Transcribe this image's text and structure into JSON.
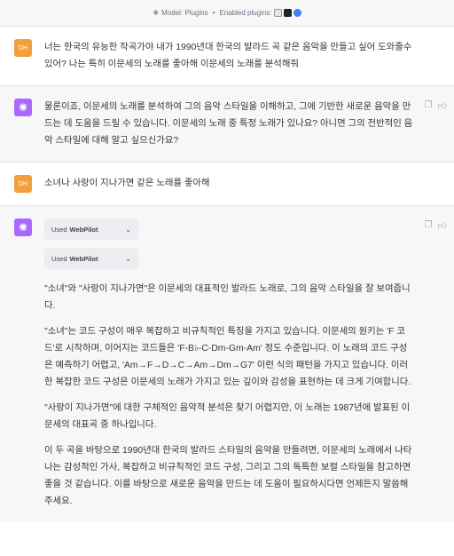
{
  "header": {
    "model_label": "Model: Plugins",
    "separator": "•",
    "plugins_label": "Enabled plugins:"
  },
  "messages": [
    {
      "role": "user",
      "avatar_text": "DH",
      "text": "너는 한국의 유능한 작곡가야 내가 1990년대 한국의 발라드 곡 같은 음악을 만들고 싶어 도와줄수 있어? 나는 특히 이문세의 노래를 좋아해 이문세의 노래를 분석해줘"
    },
    {
      "role": "assistant",
      "text": "물론이죠, 이문세의 노래를 분석하여 그의 음악 스타일을 이해하고, 그에 기반한 새로운 음악을 만드는 데 도움을 드릴 수 있습니다. 이문세의 노래 중 특정 노래가 있나요? 아니면 그의 전반적인 음악 스타일에 대해 알고 싶으신가요?"
    },
    {
      "role": "user",
      "avatar_text": "DH",
      "text": "소녀나 사랑이 지나가면 같은 노래를 좋아해"
    },
    {
      "role": "assistant",
      "plugin_chips": [
        {
          "prefix": "Used",
          "name": "WebPilot"
        },
        {
          "prefix": "Used",
          "name": "WebPilot"
        }
      ],
      "paragraphs": [
        "\"소녀\"와 \"사랑이 지나가면\"은 이문세의 대표적인 발라드 노래로, 그의 음악 스타일을 잘 보여줍니다.",
        "\"소녀\"는 코드 구성이 매우 복잡하고 비규칙적인 특징을 가지고 있습니다. 이문세의 원키는 'F 코드'로 시작하며, 이어지는 코드들은 'F-B♭-C-Dm-Gm-Am' 정도 수준입니다. 이 노래의 코드 구성은 예측하기 어렵고, 'Am→F→D→C→Am→Dm→G7' 이런 식의 패턴을 가지고 있습니다. 이러한 복잡한 코드 구성은 이문세의 노래가 가지고 있는 깊이와 감성을 표현하는 데 크게 기여합니다.",
        "\"사랑이 지나가면\"에 대한 구체적인 음악적 분석은 찾기 어렵지만, 이 노래는 1987년에 발표된 이문세의 대표곡 중 하나입니다.",
        "이 두 곡을 바탕으로 1990년대 한국의 발라드 스타일의 음악을 만들려면, 이문세의 노래에서 나타나는 감성적인 가사, 복잡하고 비규칙적인 코드 구성, 그리고 그의 독특한 보컬 스타일을 참고하면 좋을 것 같습니다. 이를 바탕으로 새로운 음악을 만드는 데 도움이 필요하시다면 언제든지 말씀해주세요."
      ]
    }
  ]
}
